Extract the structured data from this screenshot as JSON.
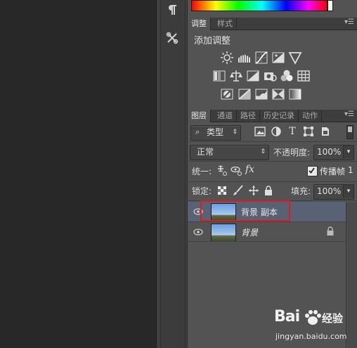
{
  "adjustments": {
    "tabs": [
      "调整",
      "样式"
    ],
    "title": "添加调整"
  },
  "layers": {
    "tabs": [
      "图层",
      "通道",
      "路径",
      "历史记录",
      "动作"
    ],
    "filter_kind": "类型",
    "blend_mode": "正常",
    "opacity_label": "不透明度:",
    "opacity_value": "100%",
    "unify_label": "统一:",
    "propagate_label": "传播帧",
    "propagate_value": "1",
    "lock_label": "锁定:",
    "fill_label": "填充:",
    "fill_value": "100%",
    "items": [
      {
        "name": "背景 副本",
        "selected": true
      },
      {
        "name": "背景",
        "selected": false
      }
    ]
  },
  "watermark": {
    "brand": "Bai",
    "brand_suffix": "经验",
    "url": "jingyan.baidu.com"
  },
  "colors": {
    "panel_bg": "#535353",
    "selected_row": "#596274",
    "highlight": "#e01b1b"
  }
}
